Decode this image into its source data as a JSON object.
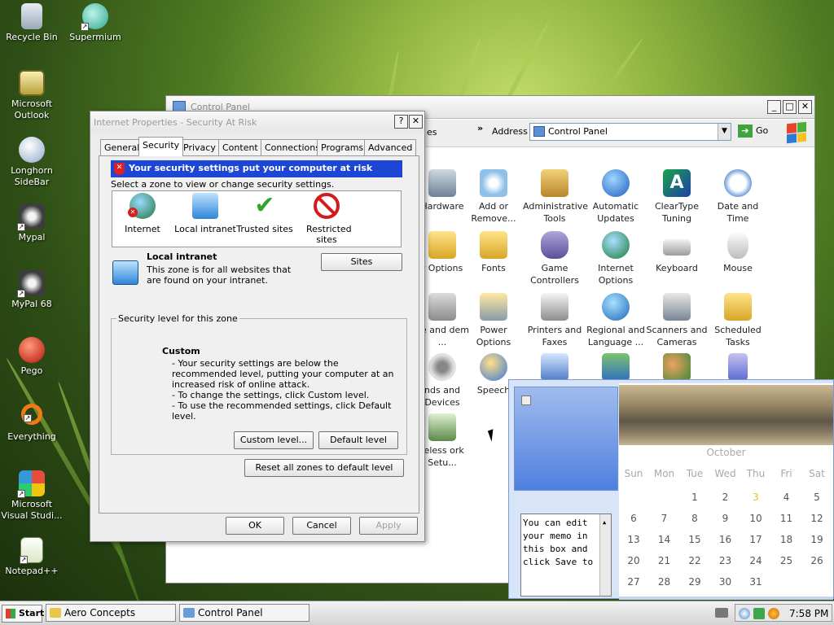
{
  "desktop_icons": [
    {
      "label": "Recycle Bin",
      "x": 0,
      "y": 0
    },
    {
      "label": "Supermium"
    },
    {
      "label": "Microsoft Outlook"
    },
    {
      "label": "Longhorn SideBar"
    },
    {
      "label": "Mypal"
    },
    {
      "label": "MyPal 68"
    },
    {
      "label": "Pego"
    },
    {
      "label": "Everything"
    },
    {
      "label": "Microsoft Visual Studi..."
    },
    {
      "label": "Notepad++"
    }
  ],
  "control_panel": {
    "title": "Control Panel",
    "address_label": "Address",
    "address_value": "Control Panel",
    "go_label": "Go",
    "chevron": "»",
    "partial_text": "es",
    "items": [
      {
        "label": "Hardware"
      },
      {
        "label": "Add or Remove..."
      },
      {
        "label": "Administrative Tools"
      },
      {
        "label": "Automatic Updates"
      },
      {
        "label": "ClearType Tuning"
      },
      {
        "label": "Date and Time"
      },
      {
        "label": "r Options"
      },
      {
        "label": "Fonts"
      },
      {
        "label": "Game Controllers"
      },
      {
        "label": "Internet Options"
      },
      {
        "label": "Keyboard"
      },
      {
        "label": "Mouse"
      },
      {
        "label": "ne and dem ..."
      },
      {
        "label": "Power Options"
      },
      {
        "label": "Printers and Faxes"
      },
      {
        "label": "Regional and Language ..."
      },
      {
        "label": "Scanners and Cameras"
      },
      {
        "label": "Scheduled Tasks"
      },
      {
        "label": "nds and Devices"
      },
      {
        "label": "Speech"
      },
      {
        "label": "reless ork Setu..."
      }
    ]
  },
  "dialog": {
    "title": "Internet Properties - Security At Risk",
    "help_label": "?",
    "close_label": "✕",
    "tabs": [
      "General",
      "Security",
      "Privacy",
      "Content",
      "Connections",
      "Programs",
      "Advanced"
    ],
    "banner": "Your security settings put your computer at risk",
    "zone_hint": "Select a zone to view or change security settings.",
    "zones": [
      {
        "label": "Internet"
      },
      {
        "label": "Local intranet"
      },
      {
        "label": "Trusted sites"
      },
      {
        "label": "Restricted sites"
      }
    ],
    "zone_name": "Local intranet",
    "zone_description": "This zone is for all websites that are found on your intranet.",
    "sites_label": "Sites",
    "level_legend": "Security level for this zone",
    "level_title": "Custom",
    "level_lines": [
      "- Your security settings are below the recommended level, putting your computer at an increased risk of online attack.",
      "- To change the settings, click Custom level.",
      "- To use the recommended settings, click Default level."
    ],
    "custom_level_label": "Custom level...",
    "default_level_label": "Default level",
    "reset_label": "Reset all zones to default level",
    "ok_label": "OK",
    "cancel_label": "Cancel",
    "apply_label": "Apply"
  },
  "gadget": {
    "memo_text": "You can edit your memo in this box and click Save to",
    "month": "October",
    "weekdays": [
      "Sun",
      "Mon",
      "Tue",
      "Wed",
      "Thu",
      "Fri",
      "Sat"
    ],
    "today": 3,
    "days": [
      1,
      2,
      3,
      4,
      5,
      6,
      7,
      8,
      9,
      10,
      11,
      12,
      13,
      14,
      15,
      16,
      17,
      18,
      19,
      20,
      21,
      22,
      23,
      24,
      25,
      26,
      27,
      28,
      29,
      30,
      31
    ],
    "first_day_index": 2
  },
  "taskbar": {
    "start_label": "Start",
    "tasks": [
      {
        "label": "Aero Concepts"
      },
      {
        "label": "Control Panel"
      }
    ],
    "clock": "7:58 PM"
  }
}
